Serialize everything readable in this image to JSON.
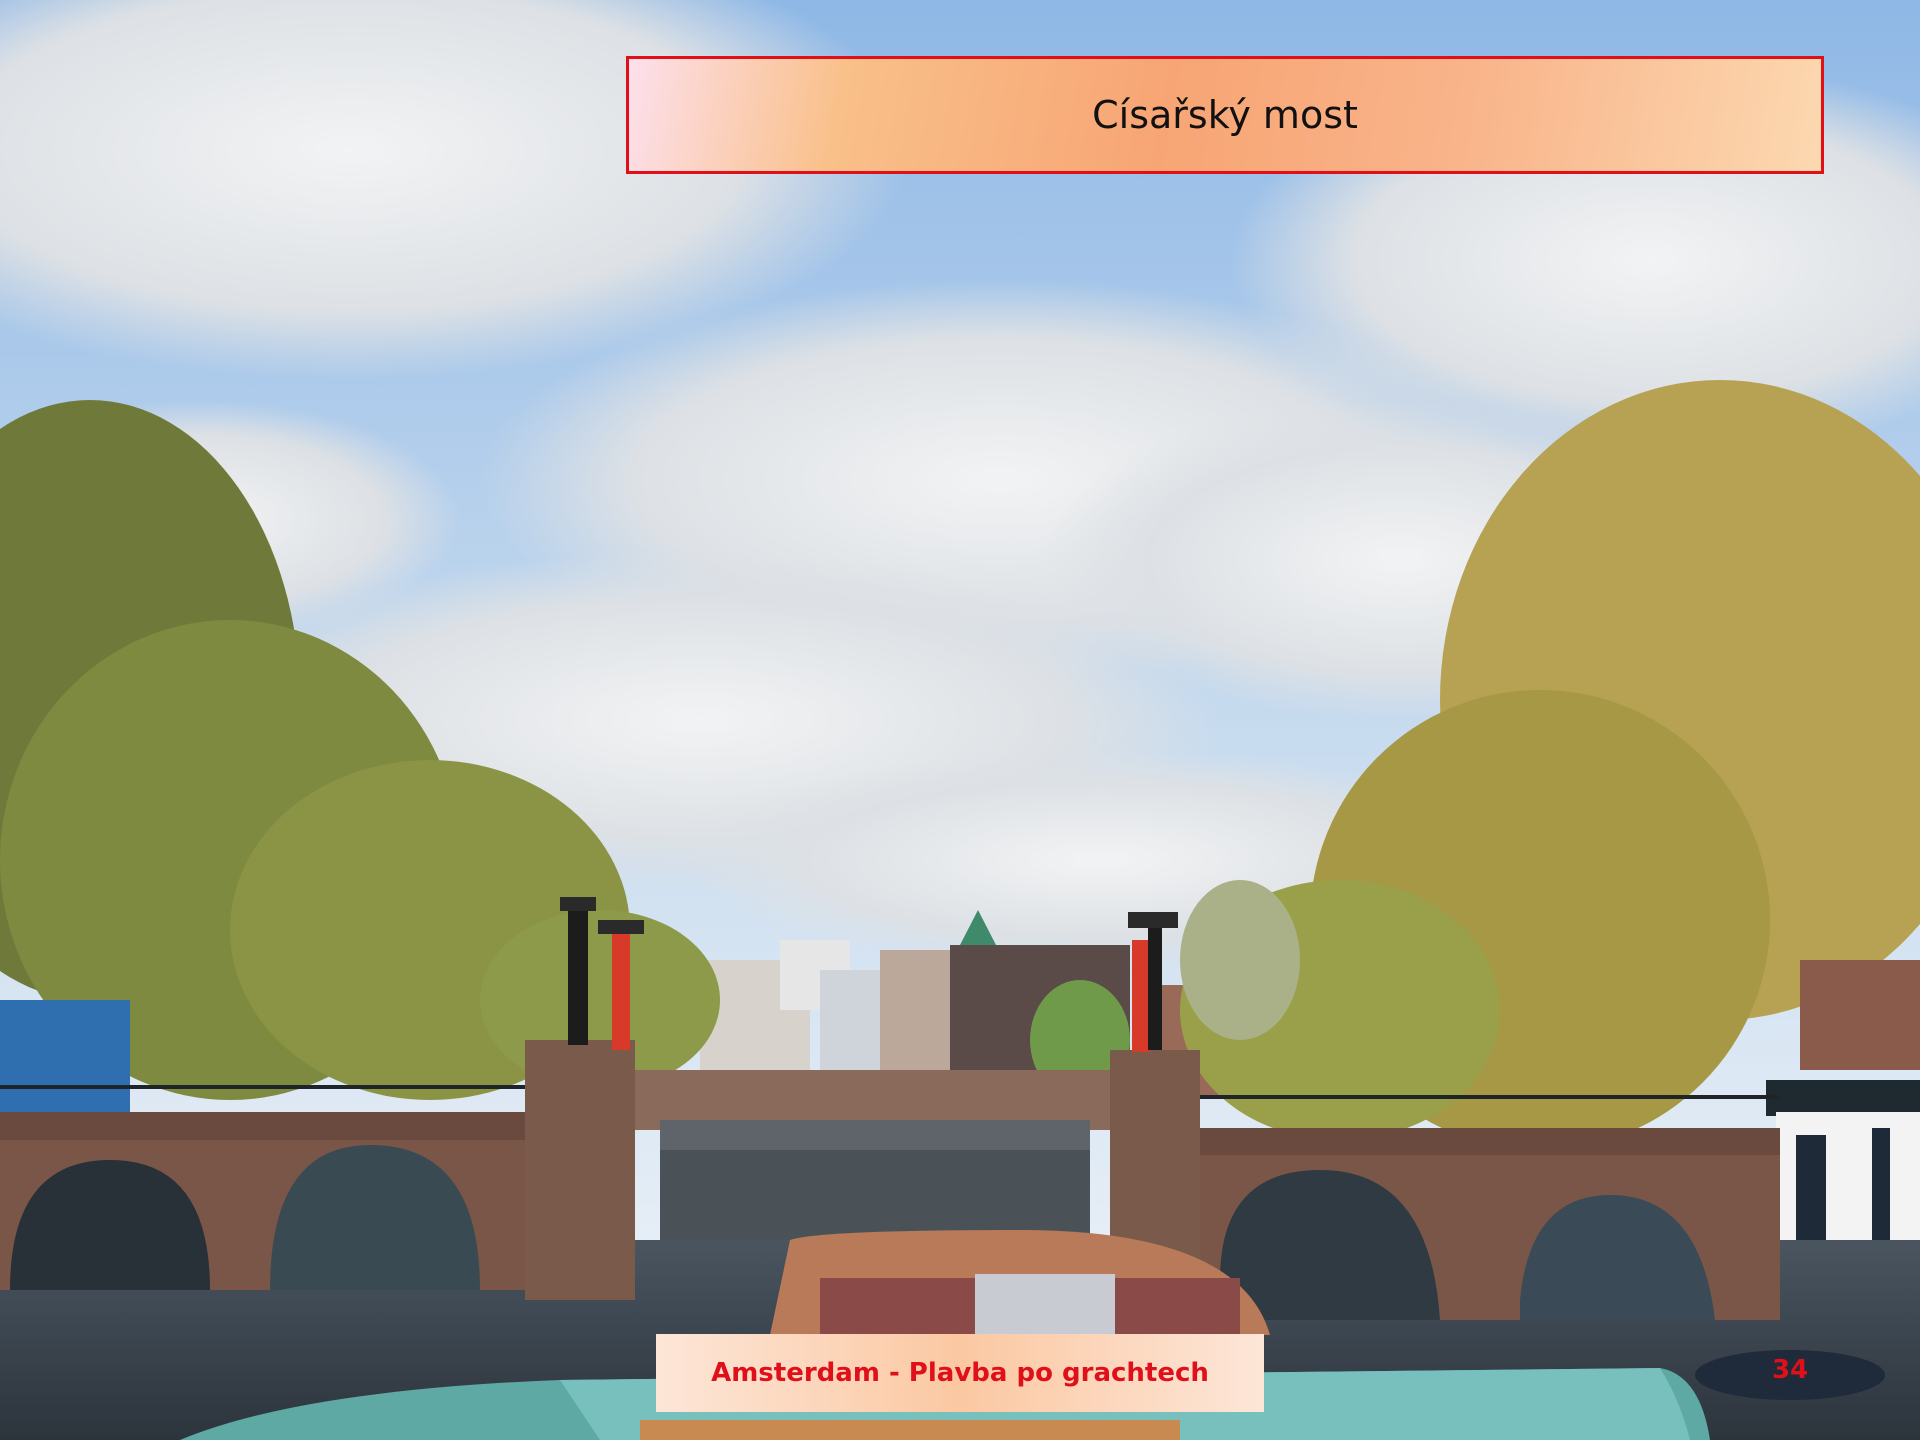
{
  "slide": {
    "title": "Císařský most",
    "footer": "Amsterdam - Plavba po grachtech",
    "page_number": "34"
  }
}
